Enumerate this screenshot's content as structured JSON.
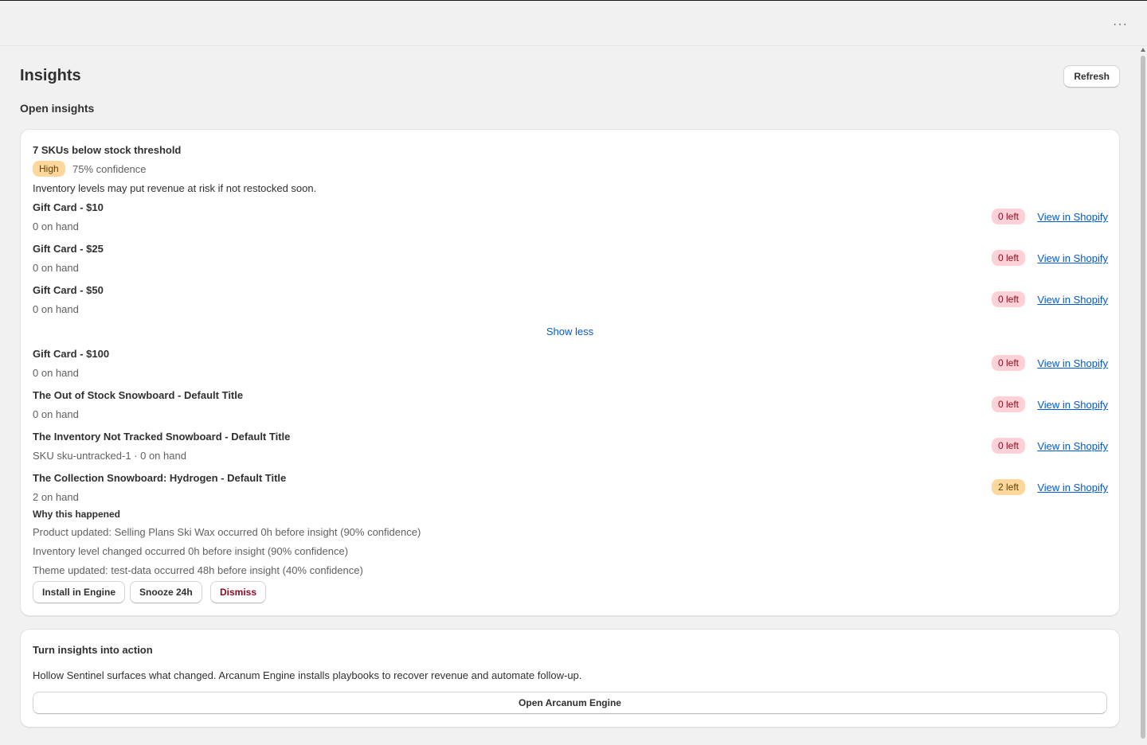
{
  "header": {
    "more_icon": "more-horizontal-icon",
    "more_glyph": "···"
  },
  "page": {
    "title": "Insights",
    "refresh_label": "Refresh",
    "section_title": "Open insights"
  },
  "insight": {
    "title": "7 SKUs below stock threshold",
    "severity": "High",
    "confidence": "75% confidence",
    "description": "Inventory levels may put revenue at risk if not restocked soon.",
    "items": [
      {
        "title": "Gift Card - $10",
        "subtitle": "0 on hand",
        "badge": "0 left",
        "badge_tone": "critical",
        "link": "View in Shopify"
      },
      {
        "title": "Gift Card - $25",
        "subtitle": "0 on hand",
        "badge": "0 left",
        "badge_tone": "critical",
        "link": "View in Shopify"
      },
      {
        "title": "Gift Card - $50",
        "subtitle": "0 on hand",
        "badge": "0 left",
        "badge_tone": "critical",
        "link": "View in Shopify"
      },
      {
        "title": "Gift Card - $100",
        "subtitle": "0 on hand",
        "badge": "0 left",
        "badge_tone": "critical",
        "link": "View in Shopify"
      },
      {
        "title": "The Out of Stock Snowboard - Default Title",
        "subtitle": "0 on hand",
        "badge": "0 left",
        "badge_tone": "critical",
        "link": "View in Shopify"
      },
      {
        "title": "The Inventory Not Tracked Snowboard - Default Title",
        "subtitle": "SKU sku-untracked-1 · 0 on hand",
        "badge": "0 left",
        "badge_tone": "critical",
        "link": "View in Shopify"
      },
      {
        "title": "The Collection Snowboard: Hydrogen - Default Title",
        "subtitle": "2 on hand",
        "badge": "2 left",
        "badge_tone": "warning",
        "link": "View in Shopify"
      }
    ],
    "show_less_label": "Show less",
    "why_title": "Why this happened",
    "reasons": [
      "Product updated: Selling Plans Ski Wax occurred 0h before insight (90% confidence)",
      "Inventory level changed occurred 0h before insight (90% confidence)",
      "Theme updated: test-data occurred 48h before insight (40% confidence)"
    ],
    "actions": {
      "install": "Install in Engine",
      "snooze": "Snooze 24h",
      "dismiss": "Dismiss"
    }
  },
  "promo": {
    "title": "Turn insights into action",
    "body": "Hollow Sentinel surfaces what changed. Arcanum Engine installs playbooks to recover revenue and automate follow-up.",
    "button": "Open Arcanum Engine"
  },
  "colors": {
    "background": "#f1f1f1",
    "card": "#ffffff",
    "link": "#005bd3",
    "critical_badge_bg": "#fed1d7",
    "critical_badge_text": "#8e0b21",
    "warning_badge_bg": "#ffd79d",
    "warning_badge_text": "#5e4200"
  }
}
